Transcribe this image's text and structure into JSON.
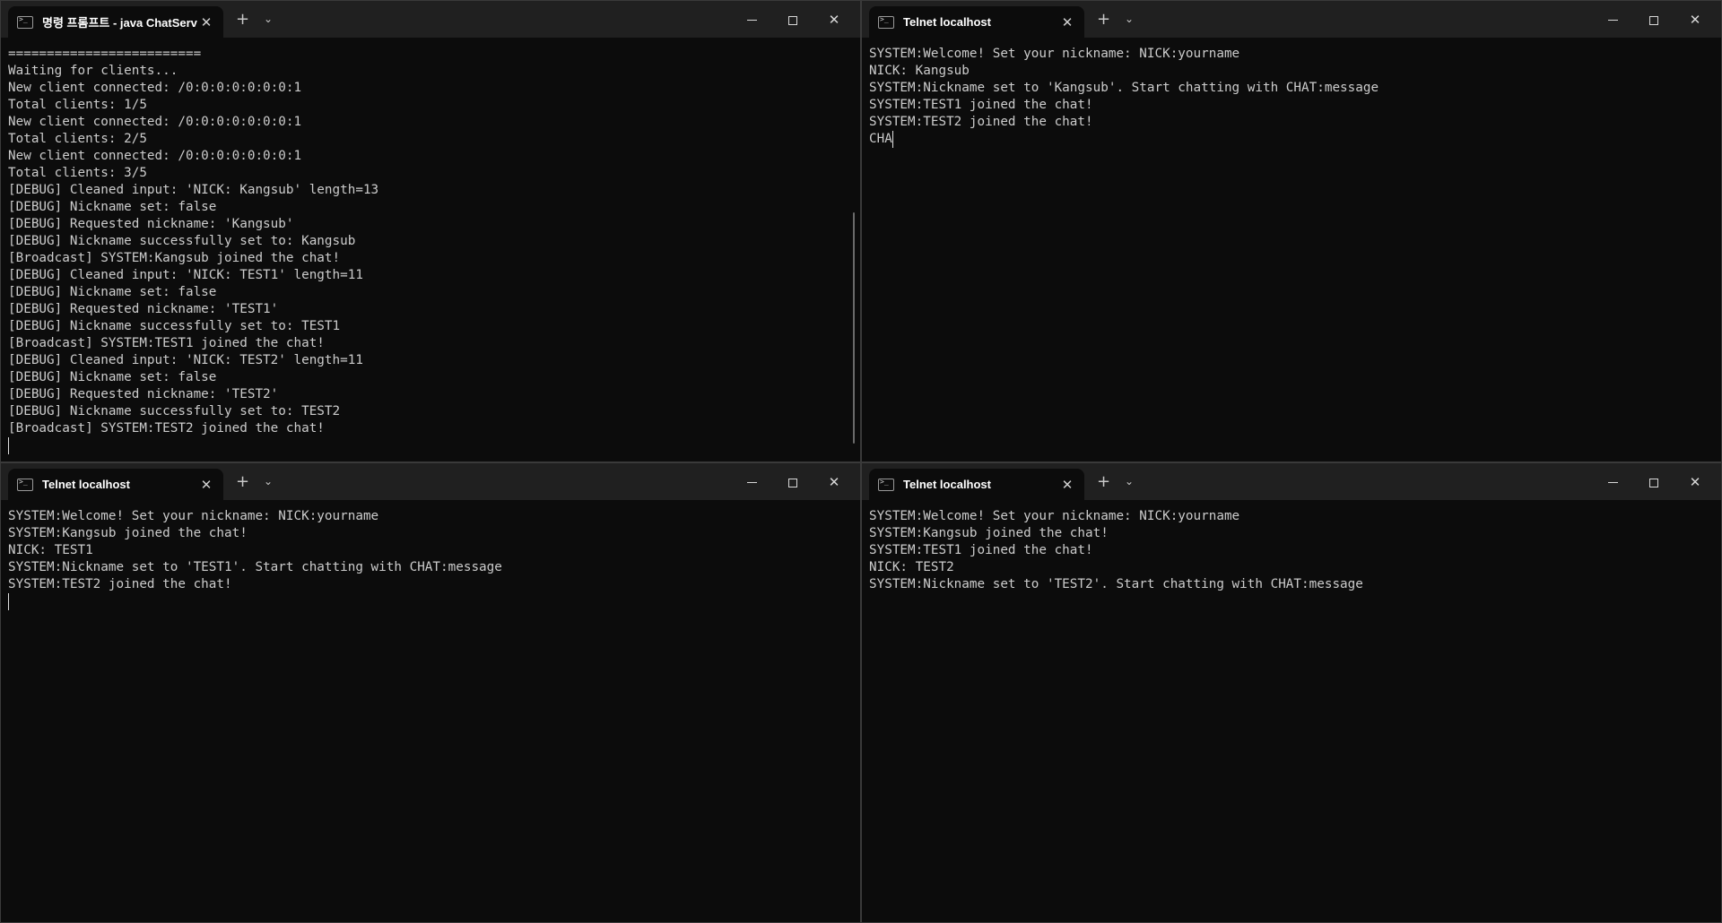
{
  "windows": [
    {
      "tab_title": "명령 프롬프트 - java  ChatServ",
      "lines": [
        "=========================",
        "Waiting for clients...",
        "New client connected: /0:0:0:0:0:0:0:1",
        "Total clients: 1/5",
        "New client connected: /0:0:0:0:0:0:0:1",
        "Total clients: 2/5",
        "New client connected: /0:0:0:0:0:0:0:1",
        "Total clients: 3/5",
        "[DEBUG] Cleaned input: 'NICK: Kangsub' length=13",
        "[DEBUG] Nickname set: false",
        "[DEBUG] Requested nickname: 'Kangsub'",
        "[DEBUG] Nickname successfully set to: Kangsub",
        "[Broadcast] SYSTEM:Kangsub joined the chat!",
        "[DEBUG] Cleaned input: 'NICK: TEST1' length=11",
        "[DEBUG] Nickname set: false",
        "[DEBUG] Requested nickname: 'TEST1'",
        "[DEBUG] Nickname successfully set to: TEST1",
        "[Broadcast] SYSTEM:TEST1 joined the chat!",
        "[DEBUG] Cleaned input: 'NICK: TEST2' length=11",
        "[DEBUG] Nickname set: false",
        "[DEBUG] Requested nickname: 'TEST2'",
        "[DEBUG] Nickname successfully set to: TEST2",
        "[Broadcast] SYSTEM:TEST2 joined the chat!"
      ],
      "input_line": ""
    },
    {
      "tab_title": "Telnet localhost",
      "lines": [
        "SYSTEM:Welcome! Set your nickname: NICK:yourname",
        "NICK: Kangsub",
        "SYSTEM:Nickname set to 'Kangsub'. Start chatting with CHAT:message",
        "SYSTEM:TEST1 joined the chat!",
        "SYSTEM:TEST2 joined the chat!"
      ],
      "input_line": "CHA"
    },
    {
      "tab_title": "Telnet localhost",
      "lines": [
        "SYSTEM:Welcome! Set your nickname: NICK:yourname",
        "SYSTEM:Kangsub joined the chat!",
        "NICK: TEST1",
        "SYSTEM:Nickname set to 'TEST1'. Start chatting with CHAT:message",
        "SYSTEM:TEST2 joined the chat!"
      ],
      "input_line": ""
    },
    {
      "tab_title": "Telnet localhost",
      "lines": [
        "SYSTEM:Welcome! Set your nickname: NICK:yourname",
        "SYSTEM:Kangsub joined the chat!",
        "SYSTEM:TEST1 joined the chat!",
        "NICK: TEST2",
        "SYSTEM:Nickname set to 'TEST2'. Start chatting with CHAT:message"
      ],
      "input_line": null
    }
  ],
  "controls": {
    "tab_close_glyph": "✕",
    "new_tab_glyph": "+",
    "dropdown_glyph": "⌄",
    "close_glyph": "✕"
  },
  "icons": {
    "tab_icon": "terminal-icon",
    "new_tab": "plus-icon",
    "dropdown": "chevron-down-icon",
    "minimize": "minimize-icon",
    "maximize": "maximize-icon",
    "close": "close-icon"
  },
  "colors": {
    "background": "#0c0c0c",
    "titlebar": "#202020",
    "text": "#cccccc"
  }
}
